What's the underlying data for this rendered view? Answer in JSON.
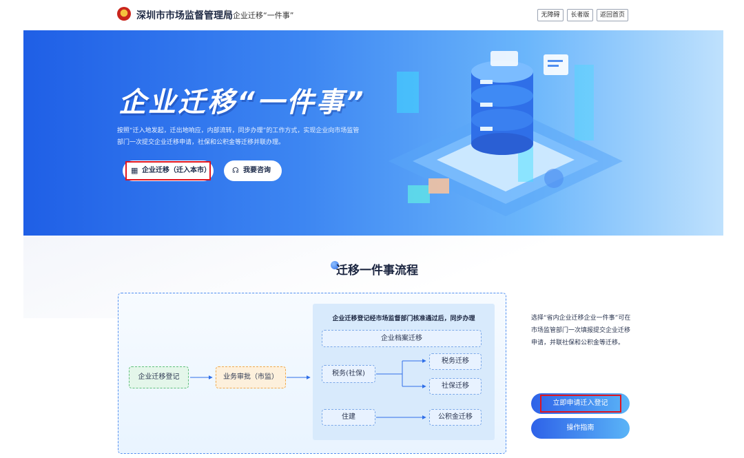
{
  "header": {
    "site_name": "深圳市市场监督管理局",
    "sub_name": "企业迁移“一件事”",
    "buttons": [
      "无障碍",
      "长者版",
      "返回首页"
    ]
  },
  "banner": {
    "title": "企业迁移“一件事”",
    "description": "按照“迁入地发起，迁出地响应，内部流转，同步办理”的工作方式，实现企业向市场监管部门一次提交企业迁移申请，社保和公积金等迁移并联办理。",
    "btn_migrate": "企业迁移（迁入本市）",
    "btn_consult": "我要咨询"
  },
  "process": {
    "title": "迁移一件事流程",
    "step1": "企业迁移登记",
    "step2": "业务审批（市监）",
    "inner_title": "企业迁移登记经市场监督部门核准通过后，同步办理",
    "archive": "企业档案迁移",
    "tax_social": "税务(社保)",
    "tax_migrate": "税务迁移",
    "social_migrate": "社保迁移",
    "housing": "住建",
    "fund_migrate": "公积金迁移"
  },
  "side": {
    "text": "选择“省内企业迁移企业一件事”可在市场监管部门一次填报提交企业迁移申请，并联社保和公积金等迁移。",
    "btn_apply": "立即申请迁入登记",
    "btn_guide": "操作指南"
  },
  "colors": {
    "primary": "#2e62e8",
    "highlight_border": "#e0141e"
  }
}
